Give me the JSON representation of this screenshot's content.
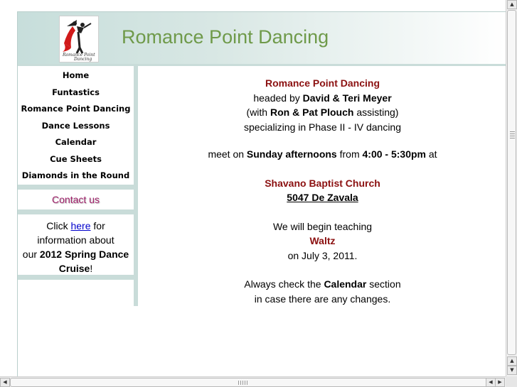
{
  "header": {
    "title": "Romance Point Dancing"
  },
  "sidebar": {
    "nav": [
      {
        "label": "Home"
      },
      {
        "label": "Funtastics"
      },
      {
        "label": "Romance Point Dancing"
      },
      {
        "label": "Dance Lessons"
      },
      {
        "label": "Calendar"
      },
      {
        "label": "Cue Sheets"
      },
      {
        "label": "Diamonds in the Round"
      }
    ],
    "contact": "Contact us",
    "promo": {
      "click": "Click",
      "link": "here",
      "for": "for",
      "line2": "information about",
      "our": "our",
      "bold": "2012 Spring Dance Cruise",
      "end": "!"
    }
  },
  "main": {
    "name": "Romance Point Dancing",
    "headed_by": "headed by",
    "leaders": "David & Teri Meyer",
    "with_open": "(with",
    "assistants": "Ron & Pat Plouch",
    "assisting": "assisting)",
    "specializing": "specializing in Phase II - IV dancing",
    "meet_on": "meet on",
    "day": "Sunday afternoons",
    "from": "from",
    "time": "4:00 - 5:30pm",
    "at": "at",
    "church": "Shavano Baptist Church",
    "address": "5047 De Zavala",
    "begin": "We will begin teaching",
    "dance": "Waltz",
    "date": "on July 3, 2011.",
    "check_pre": "Always check the",
    "calendar": "Calendar",
    "check_post": "section",
    "changes": "in case there are any changes."
  },
  "colors": {
    "title": "#6f9a4a",
    "accent_maroon": "#8b1010",
    "contact": "#a0206a",
    "frame": "#c9dcd9"
  },
  "logo": {
    "icon": "dancing-couple-logo"
  }
}
